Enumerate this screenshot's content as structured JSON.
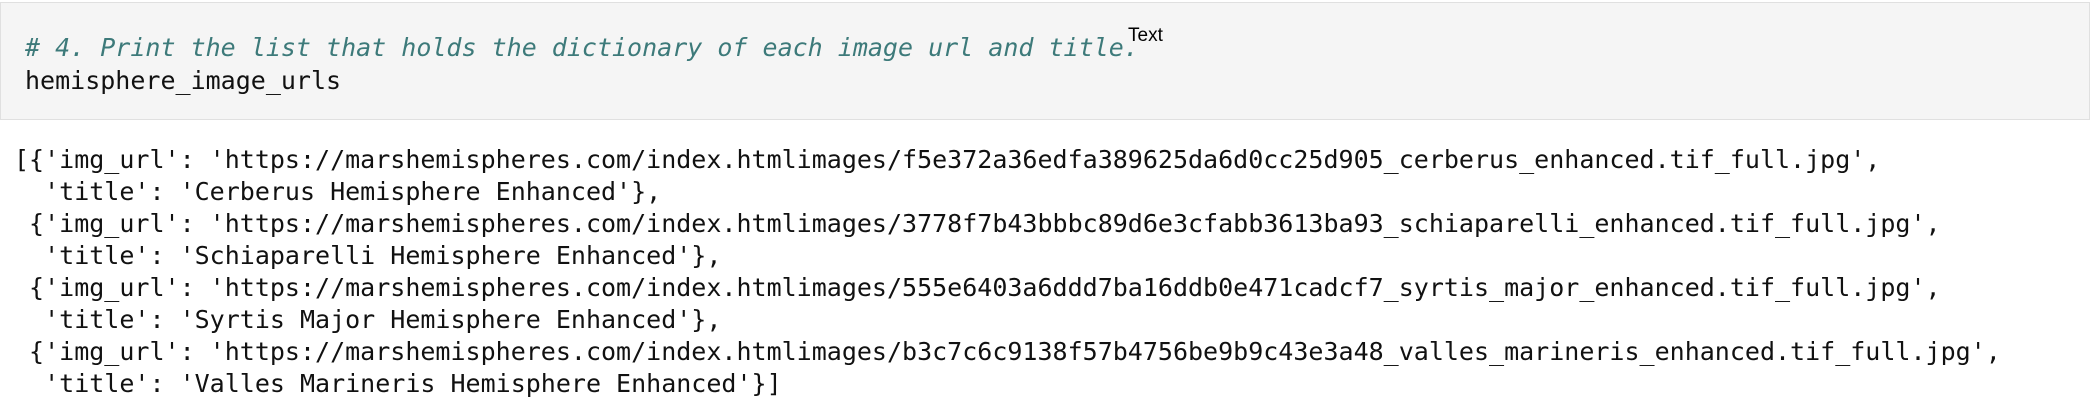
{
  "input_cell": {
    "comment": "# 4. Print the list that holds the dictionary of each image url and title.",
    "code": "hemisphere_image_urls",
    "tooltip": "Text"
  },
  "output": {
    "lines": [
      "[{'img_url': 'https://marshemispheres.com/index.htmlimages/f5e372a36edfa389625da6d0cc25d905_cerberus_enhanced.tif_full.jpg',",
      "  'title': 'Cerberus Hemisphere Enhanced'},",
      " {'img_url': 'https://marshemispheres.com/index.htmlimages/3778f7b43bbbc89d6e3cfabb3613ba93_schiaparelli_enhanced.tif_full.jpg',",
      "  'title': 'Schiaparelli Hemisphere Enhanced'},",
      " {'img_url': 'https://marshemispheres.com/index.htmlimages/555e6403a6ddd7ba16ddb0e471cadcf7_syrtis_major_enhanced.tif_full.jpg',",
      "  'title': 'Syrtis Major Hemisphere Enhanced'},",
      " {'img_url': 'https://marshemispheres.com/index.htmlimages/b3c7c6c9138f57b4756be9b9c43e3a48_valles_marineris_enhanced.tif_full.jpg',",
      "  'title': 'Valles Marineris Hemisphere Enhanced'}]"
    ]
  },
  "colors": {
    "comment": "#3d7a7a",
    "input_bg": "#f5f5f5",
    "text": "#111111"
  }
}
